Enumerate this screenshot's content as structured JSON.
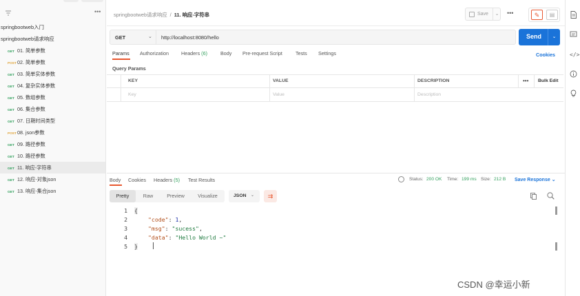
{
  "sidebar": {
    "more_glyph": "•••",
    "collections": [
      {
        "name": "springbootweb入门"
      },
      {
        "name": "springbootweb请求响应"
      }
    ],
    "items": [
      {
        "method": "GET",
        "name": "01. 简单参数"
      },
      {
        "method": "POST",
        "name": "02. 简单参数"
      },
      {
        "method": "GET",
        "name": "03. 简单实体参数"
      },
      {
        "method": "GET",
        "name": "04. 复杂实体参数"
      },
      {
        "method": "GET",
        "name": "05. 数组参数"
      },
      {
        "method": "GET",
        "name": "06. 集合参数"
      },
      {
        "method": "GET",
        "name": "07. 日期时间类型"
      },
      {
        "method": "POST",
        "name": "08. json参数"
      },
      {
        "method": "GET",
        "name": "09. 路径参数"
      },
      {
        "method": "GET",
        "name": "10. 路径参数"
      },
      {
        "method": "GET",
        "name": "11. 响应-字符串"
      },
      {
        "method": "GET",
        "name": "12. 响应-对象json"
      },
      {
        "method": "GET",
        "name": "13. 响应-集合json"
      }
    ],
    "active_index": 10
  },
  "header": {
    "breadcrumb_parent": "springbootweb请求响应",
    "breadcrumb_sep": "/",
    "breadcrumb_current": "11. 响应-字符串",
    "save_label": "Save",
    "more_glyph": "•••"
  },
  "request": {
    "method": "GET",
    "url": "http://localhost:8080/hello",
    "send_label": "Send",
    "tabs": [
      {
        "label": "Params"
      },
      {
        "label": "Authorization"
      },
      {
        "label": "Headers",
        "count": "(6)"
      },
      {
        "label": "Body"
      },
      {
        "label": "Pre-request Script"
      },
      {
        "label": "Tests"
      },
      {
        "label": "Settings"
      }
    ],
    "cookies_label": "Cookies",
    "query_params_title": "Query Params",
    "table": {
      "headers": [
        "KEY",
        "VALUE",
        "DESCRIPTION"
      ],
      "more_glyph": "•••",
      "bulk_edit": "Bulk Edit",
      "placeholders": [
        "Key",
        "Value",
        "Description"
      ]
    }
  },
  "response": {
    "tabs": [
      {
        "label": "Body"
      },
      {
        "label": "Cookies"
      },
      {
        "label": "Headers",
        "count": "(5)"
      },
      {
        "label": "Test Results"
      }
    ],
    "status_label": "Status:",
    "status_value": "200 OK",
    "time_label": "Time:",
    "time_value": "199 ms",
    "size_label": "Size:",
    "size_value": "212 B",
    "save_response": "Save Response",
    "formats": [
      "Pretty",
      "Raw",
      "Preview",
      "Visualize"
    ],
    "active_format": "Pretty",
    "language": "JSON",
    "body_lines": [
      {
        "n": "1",
        "text": "{"
      },
      {
        "n": "2",
        "key": "\"code\"",
        "value": "1",
        "type": "num",
        "comma": ","
      },
      {
        "n": "3",
        "key": "\"msg\"",
        "value": "\"sucess\"",
        "type": "str",
        "comma": ","
      },
      {
        "n": "4",
        "key": "\"data\"",
        "value": "\"Hello World ~\"",
        "type": "str",
        "comma": ""
      },
      {
        "n": "5",
        "text": "}"
      }
    ]
  },
  "watermark": "CSDN @幸运小新",
  "colors": {
    "accent_orange": "#e8572f",
    "send_blue": "#1a73d9",
    "get_green": "#2f9e5a",
    "post_orange": "#e0a53a"
  }
}
